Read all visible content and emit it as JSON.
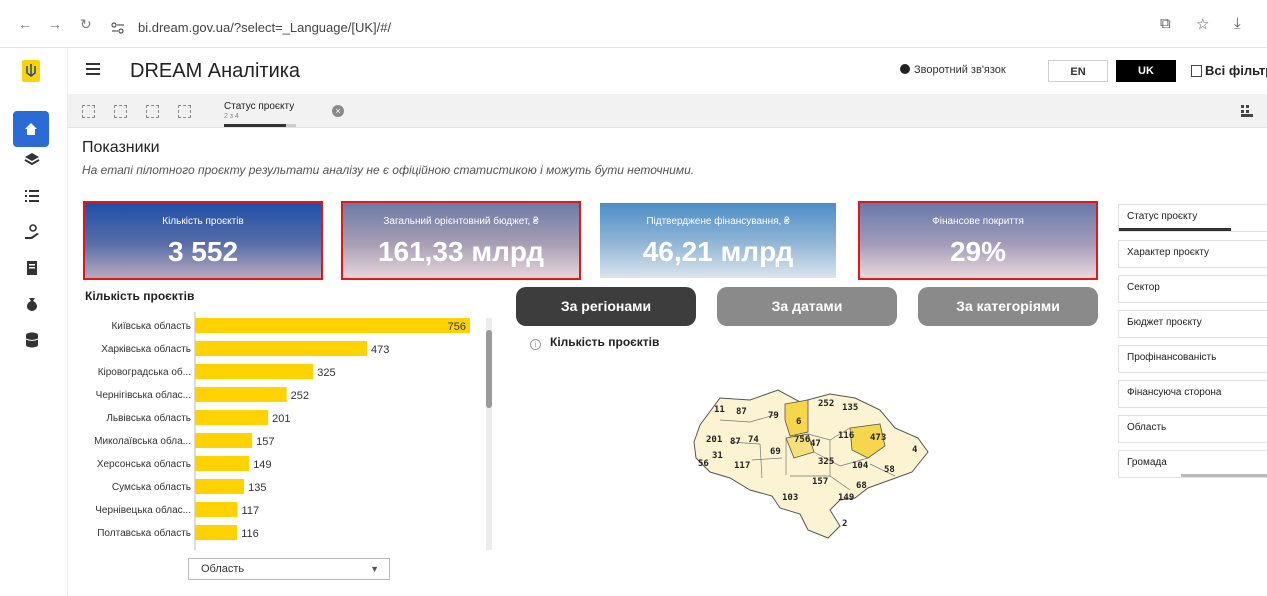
{
  "browser": {
    "url": "bi.dream.gov.ua/?select=_Language/[UK]/#/"
  },
  "header": {
    "title": "DREAM Аналітика",
    "feedback_label": "Зворотний зв'язок",
    "lang_en": "EN",
    "lang_uk": "UK",
    "filters_label": "Всі фільтр"
  },
  "selection": {
    "title": "Статус проєкту",
    "subtitle": "2 з 4"
  },
  "page": {
    "title": "Показники",
    "disclaimer": "На етапі пілотного проєкту результати аналізу не є офіційною статистикою і можуть бути неточними."
  },
  "kpis": [
    {
      "label": "Кількість проєктів",
      "value": "3 552"
    },
    {
      "label": "Загальний орієнтовний бюджет, ₴",
      "value": "161,33 млрд"
    },
    {
      "label": "Підтверджене фінансування, ₴",
      "value": "46,21 млрд"
    },
    {
      "label": "Фінансове покриття",
      "value": "29%"
    }
  ],
  "view_tabs": {
    "regions": "За регіонами",
    "dates": "За датами",
    "categories": "За категоріями"
  },
  "map": {
    "caption": "Кількість проєктів",
    "labels": [
      "11",
      "87",
      "79",
      "6",
      "252",
      "135",
      "201",
      "87",
      "74",
      "756",
      "47",
      "116",
      "473",
      "31",
      "69",
      "4",
      "56",
      "117",
      "325",
      "104",
      "58",
      "157",
      "68",
      "103",
      "149",
      "2"
    ]
  },
  "chart_data": {
    "type": "bar",
    "orientation": "horizontal",
    "title": "Кількість проєктів",
    "categories": [
      "Київська область",
      "Харківська область",
      "Кіровоградська об...",
      "Чернігівська облас...",
      "Львівська область",
      "Миколаївська обла...",
      "Херсонська область",
      "Сумська область",
      "Чернівецька облас...",
      "Полтавська область"
    ],
    "values": [
      756,
      473,
      325,
      252,
      201,
      157,
      149,
      135,
      117,
      116
    ],
    "color": "#ffd200",
    "xlim": [
      0,
      756
    ]
  },
  "region_select": {
    "value": "Область"
  },
  "filters": [
    "Статус проєкту",
    "Характер проєкту",
    "Сектор",
    "Бюджет проєкту",
    "Профінансованість",
    "Фінансуюча сторона",
    "Область",
    "Громада"
  ],
  "colors": {
    "accent": "#2b6cd4",
    "bar": "#ffd200",
    "tab_active": "#3d3d3d",
    "tab_inactive": "#8a8a8a",
    "highlight_outline": "#e01818"
  }
}
